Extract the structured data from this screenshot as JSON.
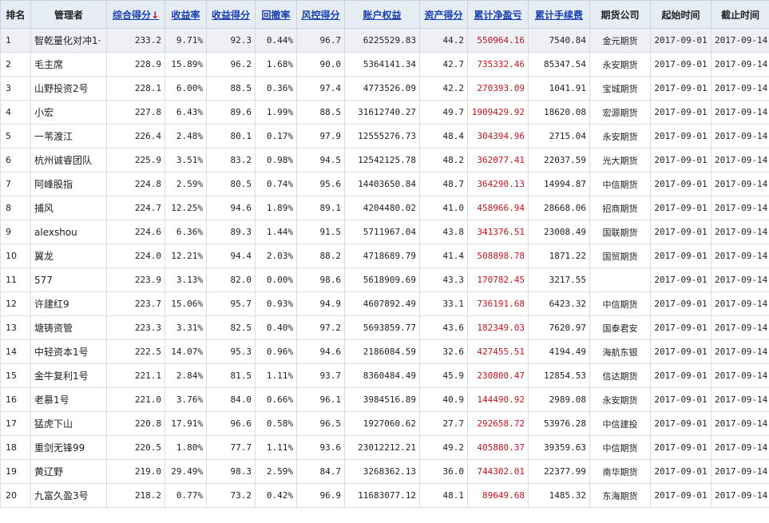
{
  "columns": [
    {
      "label": "排名",
      "sortable": false
    },
    {
      "label": "管理者",
      "sortable": false
    },
    {
      "label": "综合得分",
      "sortable": true
    },
    {
      "label": "收益率",
      "sortable": true
    },
    {
      "label": "收益得分",
      "sortable": true
    },
    {
      "label": "回撤率",
      "sortable": true
    },
    {
      "label": "风控得分",
      "sortable": true
    },
    {
      "label": "账户权益",
      "sortable": true
    },
    {
      "label": "资产得分",
      "sortable": true
    },
    {
      "label": "累计净盈亏",
      "sortable": true
    },
    {
      "label": "累计手续费",
      "sortable": true
    },
    {
      "label": "期货公司",
      "sortable": false
    },
    {
      "label": "起始时间",
      "sortable": false
    },
    {
      "label": "截止时间",
      "sortable": false
    }
  ],
  "sort_indicator": "↓",
  "rows": [
    [
      "1",
      "智乾量化对冲1·",
      "233.2",
      "9.71%",
      "92.3",
      "0.44%",
      "96.7",
      "6225529.83",
      "44.2",
      "550964.16",
      "7540.84",
      "金元期货",
      "2017-09-01",
      "2017-09-14"
    ],
    [
      "2",
      "毛主席",
      "228.9",
      "15.89%",
      "96.2",
      "1.68%",
      "90.0",
      "5364141.34",
      "42.7",
      "735332.46",
      "85347.54",
      "永安期货",
      "2017-09-01",
      "2017-09-14"
    ],
    [
      "3",
      "山野投资2号",
      "228.1",
      "6.00%",
      "88.5",
      "0.36%",
      "97.4",
      "4773526.09",
      "42.2",
      "270393.09",
      "1041.91",
      "宝城期货",
      "2017-09-01",
      "2017-09-14"
    ],
    [
      "4",
      "小宏",
      "227.8",
      "6.43%",
      "89.6",
      "1.99%",
      "88.5",
      "31612740.27",
      "49.7",
      "1909429.92",
      "18620.08",
      "宏源期货",
      "2017-09-01",
      "2017-09-14"
    ],
    [
      "5",
      "一苇渡江",
      "226.4",
      "2.48%",
      "80.1",
      "0.17%",
      "97.9",
      "12555276.73",
      "48.4",
      "304394.96",
      "2715.04",
      "永安期货",
      "2017-09-01",
      "2017-09-14"
    ],
    [
      "6",
      "杭州诚睿团队",
      "225.9",
      "3.51%",
      "83.2",
      "0.98%",
      "94.5",
      "12542125.78",
      "48.2",
      "362077.41",
      "22037.59",
      "光大期货",
      "2017-09-01",
      "2017-09-14"
    ],
    [
      "7",
      "阿峰股指",
      "224.8",
      "2.59%",
      "80.5",
      "0.74%",
      "95.6",
      "14403650.84",
      "48.7",
      "364290.13",
      "14994.87",
      "中信期货",
      "2017-09-01",
      "2017-09-14"
    ],
    [
      "8",
      "捕风",
      "224.7",
      "12.25%",
      "94.6",
      "1.89%",
      "89.1",
      "4204480.02",
      "41.0",
      "458966.94",
      "28668.06",
      "招商期货",
      "2017-09-01",
      "2017-09-14"
    ],
    [
      "9",
      "alexshou",
      "224.6",
      "6.36%",
      "89.3",
      "1.44%",
      "91.5",
      "5711967.04",
      "43.8",
      "341376.51",
      "23008.49",
      "国联期货",
      "2017-09-01",
      "2017-09-14"
    ],
    [
      "10",
      "翼龙",
      "224.0",
      "12.21%",
      "94.4",
      "2.03%",
      "88.2",
      "4718689.79",
      "41.4",
      "508898.78",
      "1871.22",
      "国贸期货",
      "2017-09-01",
      "2017-09-14"
    ],
    [
      "11",
      "577",
      "223.9",
      "3.13%",
      "82.0",
      "0.00%",
      "98.6",
      "5618909.69",
      "43.3",
      "170782.45",
      "3217.55",
      "",
      "2017-09-01",
      "2017-09-14"
    ],
    [
      "12",
      "许建红9",
      "223.7",
      "15.06%",
      "95.7",
      "0.93%",
      "94.9",
      "4607892.49",
      "33.1",
      "736191.68",
      "6423.32",
      "中信期货",
      "2017-09-01",
      "2017-09-14"
    ],
    [
      "13",
      "塘铸资管",
      "223.3",
      "3.31%",
      "82.5",
      "0.40%",
      "97.2",
      "5693859.77",
      "43.6",
      "182349.03",
      "7620.97",
      "国泰君安",
      "2017-09-01",
      "2017-09-14"
    ],
    [
      "14",
      "中轻资本1号",
      "222.5",
      "14.07%",
      "95.3",
      "0.96%",
      "94.6",
      "2186084.59",
      "32.6",
      "427455.51",
      "4194.49",
      "海航东银",
      "2017-09-01",
      "2017-09-14"
    ],
    [
      "15",
      "金牛复利1号",
      "221.1",
      "2.84%",
      "81.5",
      "1.11%",
      "93.7",
      "8360484.49",
      "45.9",
      "230800.47",
      "12854.53",
      "信达期货",
      "2017-09-01",
      "2017-09-14"
    ],
    [
      "16",
      "老慕1号",
      "221.0",
      "3.76%",
      "84.0",
      "0.66%",
      "96.1",
      "3984516.89",
      "40.9",
      "144490.92",
      "2989.08",
      "永安期货",
      "2017-09-01",
      "2017-09-14"
    ],
    [
      "17",
      "猛虎下山",
      "220.8",
      "17.91%",
      "96.6",
      "0.58%",
      "96.5",
      "1927060.62",
      "27.7",
      "292658.72",
      "53976.28",
      "中信建投",
      "2017-09-01",
      "2017-09-14"
    ],
    [
      "18",
      "重剑无锋99",
      "220.5",
      "1.80%",
      "77.7",
      "1.11%",
      "93.6",
      "23012212.21",
      "49.2",
      "405880.37",
      "39359.63",
      "中信期货",
      "2017-09-01",
      "2017-09-14"
    ],
    [
      "19",
      "黄辽野",
      "219.0",
      "29.49%",
      "98.3",
      "2.59%",
      "84.7",
      "3268362.13",
      "36.0",
      "744302.01",
      "22377.99",
      "南华期货",
      "2017-09-01",
      "2017-09-14"
    ],
    [
      "20",
      "九富久盈3号",
      "218.2",
      "0.77%",
      "73.2",
      "0.42%",
      "96.9",
      "11683077.12",
      "48.1",
      "89649.68",
      "1485.32",
      "东海期货",
      "2017-09-01",
      "2017-09-14"
    ]
  ]
}
